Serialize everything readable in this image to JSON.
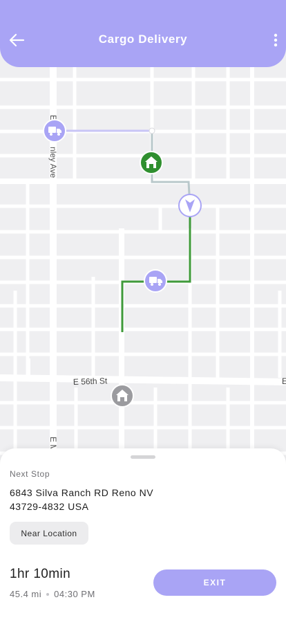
{
  "header": {
    "title": "Cargo Delivery",
    "back_icon": "arrow-left-icon",
    "more_icon": "more-vertical-icon"
  },
  "map": {
    "streets": {
      "vertical_1": "E",
      "vertical_1b": "nley Ave",
      "horizontal_1": "E 56th St",
      "vertical_2": "E M",
      "right_edge": "E"
    },
    "colors": {
      "route_active": "#3f9a3a",
      "route_pending": "#b9c8cb",
      "route_start": "#c8c5f6",
      "marker": "#a9a4f5",
      "home_marker": "#2f8f2f",
      "origin_marker": "#9b9b9f"
    }
  },
  "sheet": {
    "next_label": "Next Stop",
    "address_line1": "6843 Silva Ranch RD Reno NV",
    "address_line2": "43729-4832 USA",
    "near_button": "Near Location",
    "eta": "1hr 10min",
    "distance": "45.4 mi",
    "time": "04:30 PM",
    "exit_button": "EXIT"
  },
  "colors": {
    "accent": "#a9a4f5",
    "background": "#efeff1"
  }
}
